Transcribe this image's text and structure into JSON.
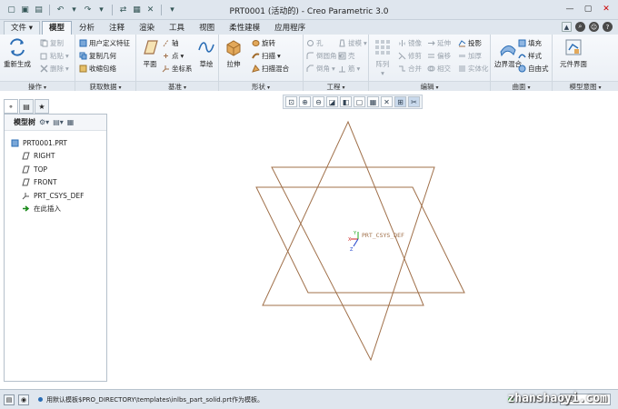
{
  "window": {
    "title": "PRT0001 (活动的) - Creo Parametric 3.0"
  },
  "tabs": [
    "文件",
    "模型",
    "分析",
    "注释",
    "渲染",
    "工具",
    "视图",
    "柔性建模",
    "应用程序"
  ],
  "active_tab": "模型",
  "ribbon": {
    "regenerate": "重新生成",
    "copy": "复制",
    "paste": "粘贴",
    "delete": "删除",
    "udf": "用户定义特征",
    "copy_geom": "复制几何",
    "shrinkwrap": "收缩包络",
    "plane": "平面",
    "axis": "轴",
    "point": "点",
    "csys": "坐标系",
    "sketch": "草绘",
    "extrude": "拉伸",
    "revolve": "旋转",
    "sweep": "扫描",
    "swept_blend": "扫描混合",
    "hole": "孔",
    "round": "倒圆角",
    "chamfer": "倒角",
    "draft": "拔模",
    "shell": "壳",
    "rib": "筋",
    "pattern": "阵列",
    "mirror": "镜像",
    "trim": "修剪",
    "merge": "合并",
    "extend": "延伸",
    "offset": "偏移",
    "intersect": "相交",
    "project": "投影",
    "thicken": "加厚",
    "solidify": "实体化",
    "boundary_blend": "边界混合",
    "fill": "填充",
    "style": "样式",
    "freestyle": "自由式",
    "component_interface": "元件界面",
    "groups": {
      "operations": "操作",
      "get_data": "获取数据",
      "datum": "基准",
      "shapes": "形状",
      "engineering": "工程",
      "editing": "编辑",
      "surfaces": "曲面",
      "model_intent": "模型意图"
    }
  },
  "left_panel": {
    "header": "模型树",
    "items": [
      {
        "label": "PRT0001.PRT",
        "icon": "part-icon"
      },
      {
        "label": "RIGHT",
        "icon": "datum-plane-icon"
      },
      {
        "label": "TOP",
        "icon": "datum-plane-icon"
      },
      {
        "label": "FRONT",
        "icon": "datum-plane-icon"
      },
      {
        "label": "PRT_CSYS_DEF",
        "icon": "csys-icon"
      },
      {
        "label": "在此插入",
        "icon": "insert-here-icon"
      }
    ]
  },
  "graphics": {
    "csys_label": "PRT_CSYS_DEF"
  },
  "status": {
    "message": "用默认模板$PRO_DIRECTORY\\templates\\inlbs_part_solid.prt作为模板。",
    "filter": "全部"
  },
  "watermark": "zhanshaoyi.com",
  "colors": {
    "datum": "#a0704a",
    "csys_x": "#cc2222",
    "csys_y": "#22aa22",
    "csys_z": "#2244cc",
    "accent": "#2a6db5"
  }
}
